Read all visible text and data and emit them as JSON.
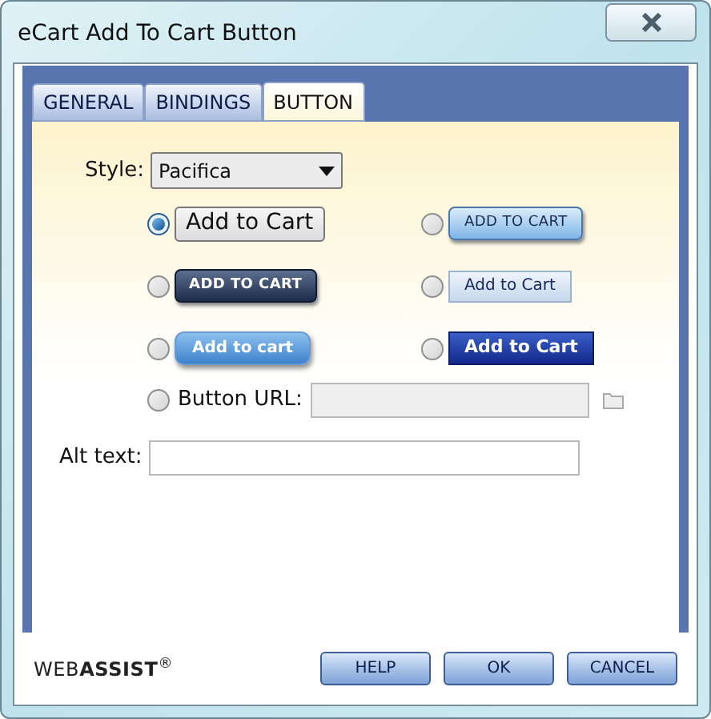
{
  "window": {
    "title": "eCart Add To Cart Button"
  },
  "tabs": [
    {
      "label": "GENERAL",
      "selected": false
    },
    {
      "label": "BINDINGS",
      "selected": false
    },
    {
      "label": "BUTTON",
      "selected": true
    }
  ],
  "style": {
    "label": "Style:",
    "value": "Pacifica"
  },
  "options": [
    {
      "kind": "plain",
      "label": "Add to Cart",
      "selected": true
    },
    {
      "kind": "light",
      "label": "ADD TO CART",
      "selected": false
    },
    {
      "kind": "dark",
      "label": "ADD TO CART",
      "selected": false
    },
    {
      "kind": "pale",
      "label": "Add to Cart",
      "selected": false
    },
    {
      "kind": "glossy",
      "label": "Add to cart",
      "selected": false
    },
    {
      "kind": "solid",
      "label": "Add to Cart",
      "selected": false
    }
  ],
  "button_url": {
    "label": "Button URL:",
    "selected": false
  },
  "alt_text": {
    "label": "Alt text:"
  },
  "logo": "WEB**ASSIST**$^{®}$",
  "buttons": [
    "HELP",
    "OK",
    "CANCEL"
  ]
}
